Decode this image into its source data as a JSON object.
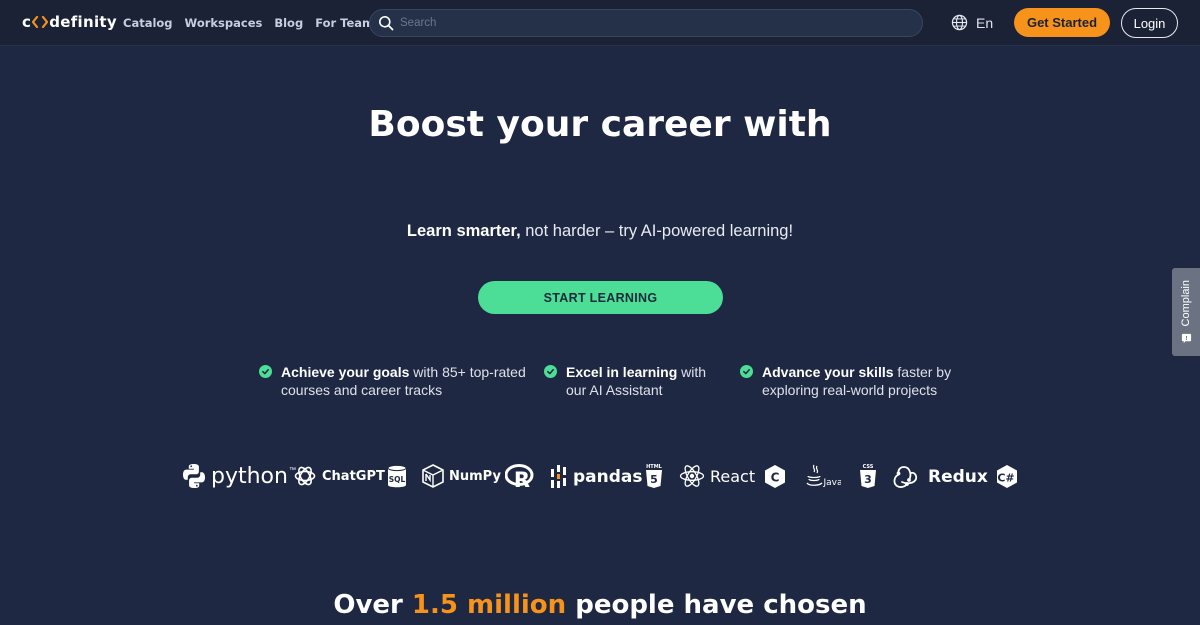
{
  "header": {
    "logo_text": "codefinity",
    "logo_prefix": "c",
    "logo_suffix": "definity",
    "nav": [
      "Catalog",
      "Workspaces",
      "Blog",
      "For Teams"
    ],
    "search_placeholder": "Search",
    "language": "En",
    "get_started_label": "Get Started",
    "login_label": "Login"
  },
  "hero": {
    "title": "Boost your career with",
    "tagline_bold": "Learn smarter,",
    "tagline_rest": " not harder – try AI-powered learning!",
    "cta_label": "START LEARNING"
  },
  "features": [
    {
      "bold": "Achieve your goals",
      "line1_rest": " with 85+ top-rated",
      "line2": "courses and career tracks"
    },
    {
      "bold": "Excel in learning",
      "line1_rest": " with",
      "line2": "our AI Assistant"
    },
    {
      "bold": "Advance your skills",
      "line1_rest": " faster by",
      "line2": "exploring real-world projects"
    }
  ],
  "technologies": {
    "python": "python",
    "python_tm": "™",
    "chatgpt": "ChatGPT",
    "sql": "SQL",
    "numpy": "NumPy",
    "r": "R",
    "pandas": "pandas",
    "html": "HTML",
    "react": "React",
    "c": "C",
    "java": "Java",
    "css": "CSS",
    "redux": "Redux",
    "csharp": "C#"
  },
  "stats": {
    "prefix": "Over ",
    "highlight": "1.5 million",
    "suffix": " people have chosen"
  },
  "complain_label": "Complain",
  "colors": {
    "background": "#1e2842",
    "header": "#1b2236",
    "accent_orange": "#f7931a",
    "accent_green": "#4cde96"
  }
}
